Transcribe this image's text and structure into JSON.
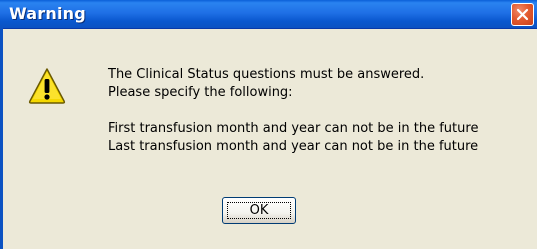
{
  "dialog": {
    "title": "Warning",
    "icon": "warning-icon",
    "message_lines": [
      "The Clinical Status questions must be answered.",
      "Please specify the following:",
      "First transfusion month and year can not be in the future",
      "Last transfusion month and year can not be in the future"
    ],
    "ok_label": "OK"
  },
  "colors": {
    "titlebar": "#0a58cf",
    "dialog_bg": "#ece9d8",
    "close_button": "#e35b30",
    "warning_yellow": "#f5d800"
  }
}
